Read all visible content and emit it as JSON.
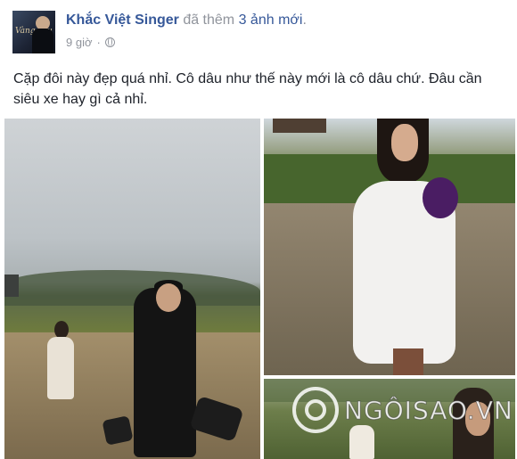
{
  "post": {
    "author": "Khắc Việt Singer",
    "action_prefix": "đã thêm",
    "action_count": "3 ảnh mới",
    "action_suffix": ".",
    "timestamp": "9 giờ",
    "separator": "·",
    "privacy_icon": "globe-icon",
    "caption": "Cặp đôi này đẹp quá nhỉ. Cô dâu như thế này mới là cô dâu chứ. Đâu cần siêu xe hay gì cả nhỉ.",
    "avatar_text": "Vàng Yêu"
  },
  "photos": [
    {
      "alt": "groom walking on muddy road"
    },
    {
      "alt": "bride holding purple bouquet"
    },
    {
      "alt": "couple in field"
    }
  ],
  "watermark": {
    "text": "NGÔISAO.VN",
    "icon": "ngoisao-logo-icon"
  },
  "colors": {
    "link": "#365899",
    "meta": "#90949c",
    "text": "#1d2129"
  }
}
